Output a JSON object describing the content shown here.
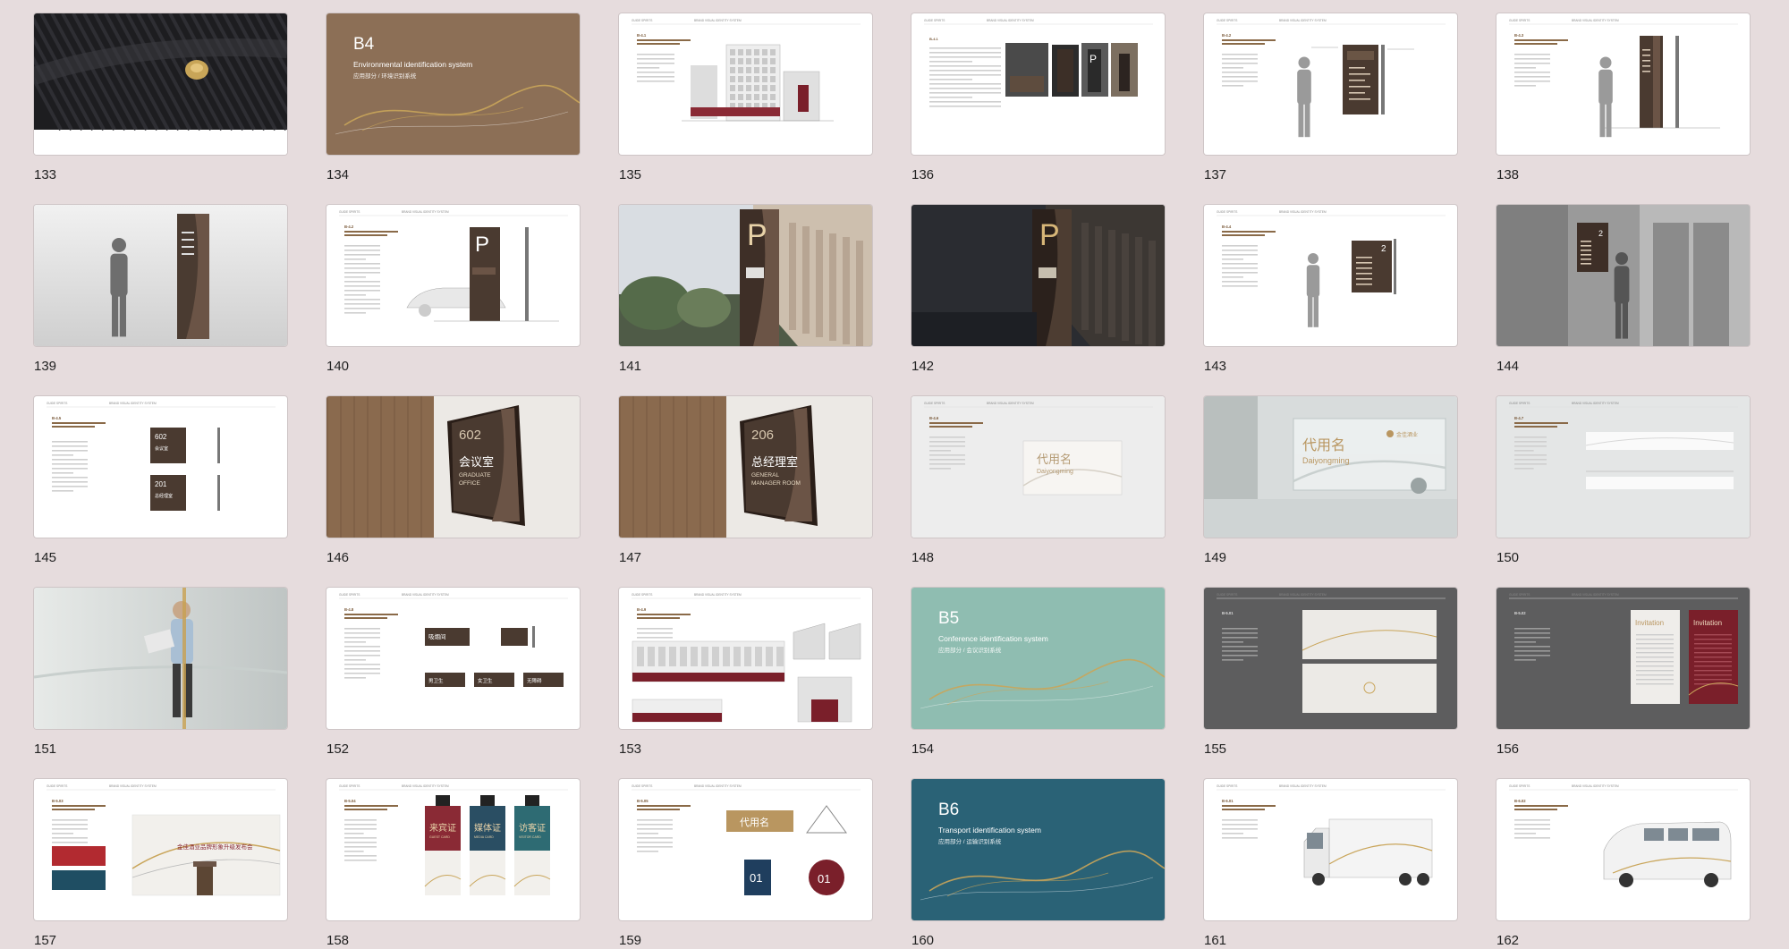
{
  "header_left": "GUIDE SPIRITS",
  "header_center": "BRAND VISUAL IDENTITY SYSTEM",
  "slides": [
    {
      "num": "133",
      "kind": "photo-fabric"
    },
    {
      "num": "134",
      "kind": "chapter",
      "bg": "#8c6f56",
      "code": "B4",
      "title": "Environmental identification system",
      "subtitle": "应用部分 / 环境识别系统"
    },
    {
      "num": "135",
      "kind": "doc-building",
      "section": "B-4.1"
    },
    {
      "num": "136",
      "kind": "doc-photos"
    },
    {
      "num": "137",
      "kind": "doc-sign-person",
      "section": "B-4.2"
    },
    {
      "num": "138",
      "kind": "doc-totem",
      "section": "B-4.3"
    },
    {
      "num": "139",
      "kind": "render-totem"
    },
    {
      "num": "140",
      "kind": "doc-parking",
      "section": "B-4.2"
    },
    {
      "num": "141",
      "kind": "photo-parking-day"
    },
    {
      "num": "142",
      "kind": "photo-parking-night"
    },
    {
      "num": "143",
      "kind": "doc-wallsign",
      "section": "B-4.4"
    },
    {
      "num": "144",
      "kind": "render-elevator"
    },
    {
      "num": "145",
      "kind": "doc-doorplates",
      "section": "B-4.5",
      "plate_a": "602",
      "label_a": "会议室",
      "plate_b": "201",
      "label_b": "总经理室"
    },
    {
      "num": "146",
      "kind": "render-doorplate",
      "room": "602",
      "cn": "会议室",
      "en1": "GRADUATE",
      "en2": "OFFICE"
    },
    {
      "num": "147",
      "kind": "render-doorplate",
      "room": "206",
      "cn": "总经理室",
      "en1": "GENERAL",
      "en2": "MANAGER ROOM"
    },
    {
      "num": "148",
      "kind": "doc-nameplate",
      "section": "B-4.6",
      "name_cn": "代用名",
      "name_en": "Daiyongming"
    },
    {
      "num": "149",
      "kind": "render-nameplate",
      "name_cn": "代用名",
      "name_en": "Daiyongming",
      "logo": "金佳酒业"
    },
    {
      "num": "150",
      "kind": "doc-glass",
      "section": "B-4.7"
    },
    {
      "num": "151",
      "kind": "photo-man"
    },
    {
      "num": "152",
      "kind": "doc-tags",
      "section": "B-4.8",
      "tag_main": "吸烟间",
      "tags": [
        "男卫生",
        "女卫生",
        "无障碍"
      ]
    },
    {
      "num": "153",
      "kind": "doc-facade",
      "section": "B-4.9"
    },
    {
      "num": "154",
      "kind": "chapter",
      "bg": "#8fbdb1",
      "code": "B5",
      "title": "Conference identification system",
      "subtitle": "应用部分 / 会议识别系统"
    },
    {
      "num": "155",
      "kind": "dark-invite",
      "section": "B-5.01"
    },
    {
      "num": "156",
      "kind": "dark-invitation",
      "section": "B-5.02",
      "invite_label": "Invitation"
    },
    {
      "num": "157",
      "kind": "doc-backdrop",
      "section": "B-5.03",
      "banner": "金佳酒业品牌形象升级发布会"
    },
    {
      "num": "158",
      "kind": "doc-badges",
      "section": "B-5.04",
      "badges": [
        "来宾证",
        "媒体证",
        "访客证"
      ],
      "badges_en": [
        "GUEST CARD",
        "MEDIA CARD",
        "VISITOR CARD"
      ]
    },
    {
      "num": "159",
      "kind": "doc-tablecards",
      "section": "B-5.05",
      "card_name": "代用名",
      "table_a": "01",
      "table_b": "01"
    },
    {
      "num": "160",
      "kind": "chapter",
      "bg": "#2a6276",
      "code": "B6",
      "title": "Transport identification system",
      "subtitle": "应用部分 / 运输识别系统"
    },
    {
      "num": "161",
      "kind": "doc-truck",
      "section": "B-6.01"
    },
    {
      "num": "162",
      "kind": "doc-van",
      "section": "B-6.02"
    }
  ]
}
